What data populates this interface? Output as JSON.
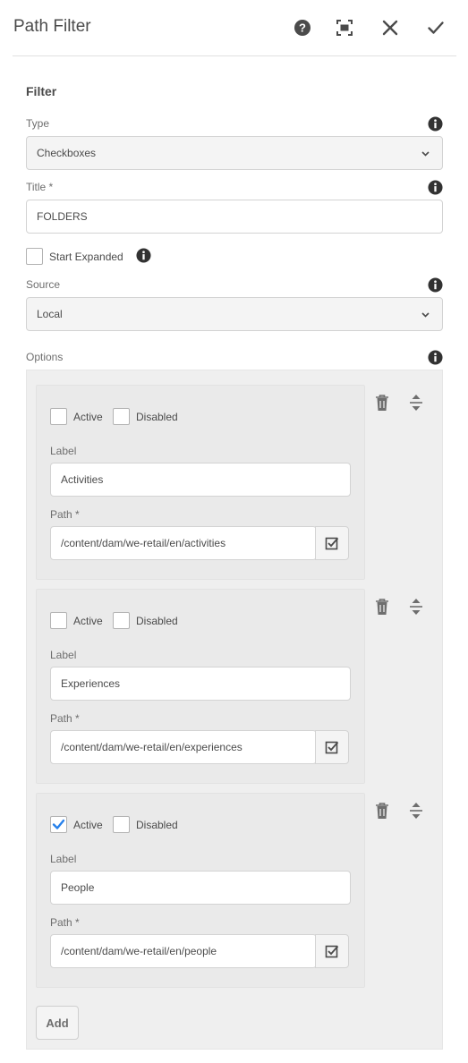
{
  "header": {
    "title": "Path Filter",
    "help_icon": "help-icon",
    "fullscreen_icon": "fullscreen-icon",
    "close_icon": "close-icon",
    "done_icon": "checkmark-icon"
  },
  "section": {
    "title": "Filter"
  },
  "type_field": {
    "label": "Type",
    "value": "Checkboxes"
  },
  "title_field": {
    "label": "Title *",
    "value": "FOLDERS"
  },
  "start_expanded": {
    "label": "Start Expanded",
    "checked": false
  },
  "source_field": {
    "label": "Source",
    "value": "Local"
  },
  "options": {
    "label": "Options",
    "items": [
      {
        "active_label": "Active",
        "active_checked": false,
        "disabled_label": "Disabled",
        "disabled_checked": false,
        "label_label": "Label",
        "label_value": "Activities",
        "path_label": "Path *",
        "path_value": "/content/dam/we-retail/en/activities"
      },
      {
        "active_label": "Active",
        "active_checked": false,
        "disabled_label": "Disabled",
        "disabled_checked": false,
        "label_label": "Label",
        "label_value": "Experiences",
        "path_label": "Path *",
        "path_value": "/content/dam/we-retail/en/experiences"
      },
      {
        "active_label": "Active",
        "active_checked": true,
        "disabled_label": "Disabled",
        "disabled_checked": false,
        "label_label": "Label",
        "label_value": "People",
        "path_label": "Path *",
        "path_value": "/content/dam/we-retail/en/people"
      }
    ],
    "add_label": "Add"
  },
  "colors": {
    "accent": "#2680eb",
    "text": "#4b4b4b",
    "panel": "#efefef"
  }
}
